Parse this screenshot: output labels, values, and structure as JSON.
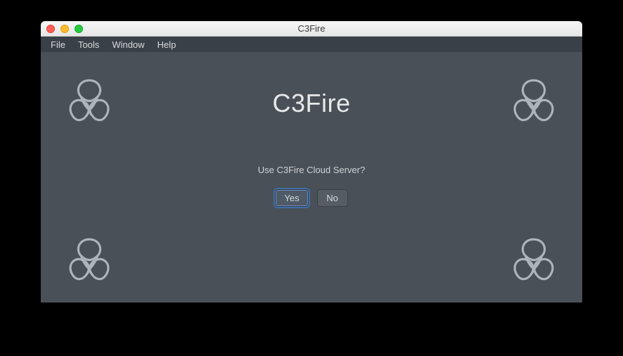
{
  "window": {
    "title": "C3Fire"
  },
  "menubar": {
    "items": [
      {
        "label": "File"
      },
      {
        "label": "Tools"
      },
      {
        "label": "Window"
      },
      {
        "label": "Help"
      }
    ]
  },
  "main": {
    "heading": "C3Fire",
    "prompt": "Use C3Fire Cloud Server?",
    "buttons": {
      "yes": "Yes",
      "no": "No"
    }
  },
  "icons": {
    "corner": "knot-logo"
  }
}
